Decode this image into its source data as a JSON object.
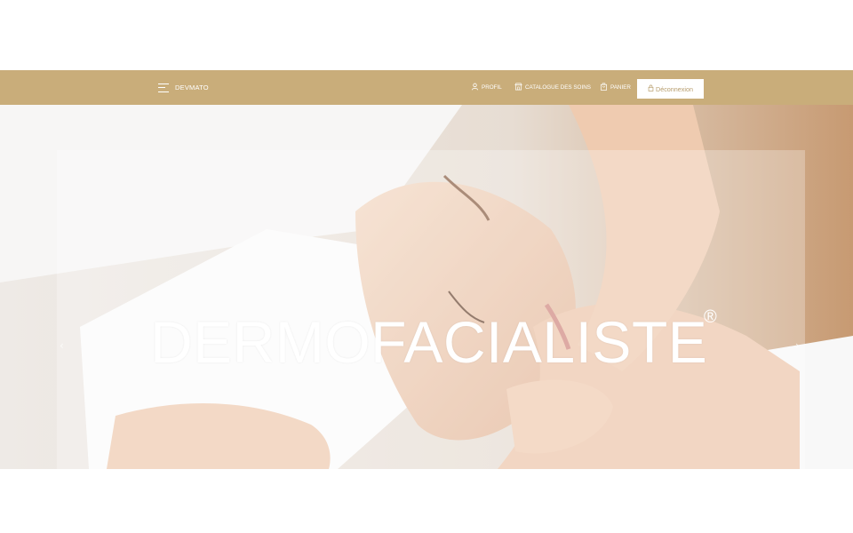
{
  "header": {
    "brand": "DEVMATO",
    "nav": [
      {
        "label": "PROFIL",
        "icon": "user-icon"
      },
      {
        "label": "CATALOGUE DES SOINS",
        "icon": "store-icon"
      },
      {
        "label": "PANIER",
        "icon": "shopping-bag-icon"
      }
    ],
    "logout": {
      "label": "Déconnexion",
      "icon": "lock-icon"
    }
  },
  "hero": {
    "title": "DERMOFACIALISTE",
    "registered": "®",
    "prev_arrow": "‹",
    "next_arrow": "›"
  },
  "colors": {
    "navbar": "#c9ad7a",
    "logout_text": "#b79d6d",
    "white": "#ffffff"
  }
}
